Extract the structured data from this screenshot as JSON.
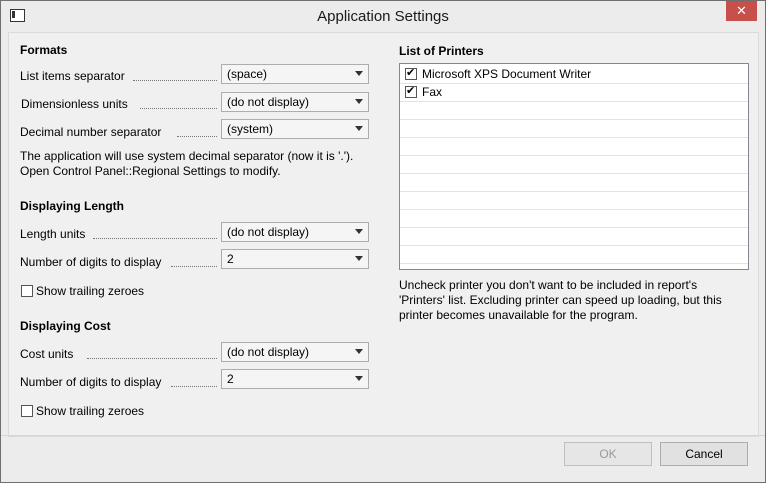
{
  "window": {
    "title": "Application Settings",
    "close_glyph": "✕",
    "icon": "app-window-icon"
  },
  "formats": {
    "heading": "Formats",
    "list_sep_label": "List items separator",
    "list_sep_value": "(space)",
    "dimless_label": "Dimensionless units",
    "dimless_value": "(do not display)",
    "decimal_label": "Decimal number separator",
    "decimal_value": "(system)",
    "info_line1": "The application will use system decimal separator (now it is '.').",
    "info_line2": "Open Control Panel::Regional Settings to modify."
  },
  "length": {
    "heading": "Displaying Length",
    "units_label": "Length units",
    "units_value": "(do not display)",
    "digits_label": "Number of digits to display",
    "digits_value": "2",
    "trailing_label": "Show trailing zeroes",
    "trailing_checked": false
  },
  "cost": {
    "heading": "Displaying Cost",
    "units_label": "Cost units",
    "units_value": "(do not display)",
    "digits_label": "Number of digits to display",
    "digits_value": "2",
    "trailing_label": "Show trailing zeroes",
    "trailing_checked": false
  },
  "printers": {
    "heading": "List of Printers",
    "items": [
      {
        "name": "Microsoft XPS Document Writer",
        "checked": true
      },
      {
        "name": "Fax",
        "checked": true
      }
    ],
    "note_line1": "Uncheck printer you don't want to be included in report's",
    "note_line2": "'Printers' list. Excluding printer can speed up loading, but this",
    "note_line3": "printer becomes unavailable for the program."
  },
  "buttons": {
    "ok": "OK",
    "cancel": "Cancel"
  }
}
